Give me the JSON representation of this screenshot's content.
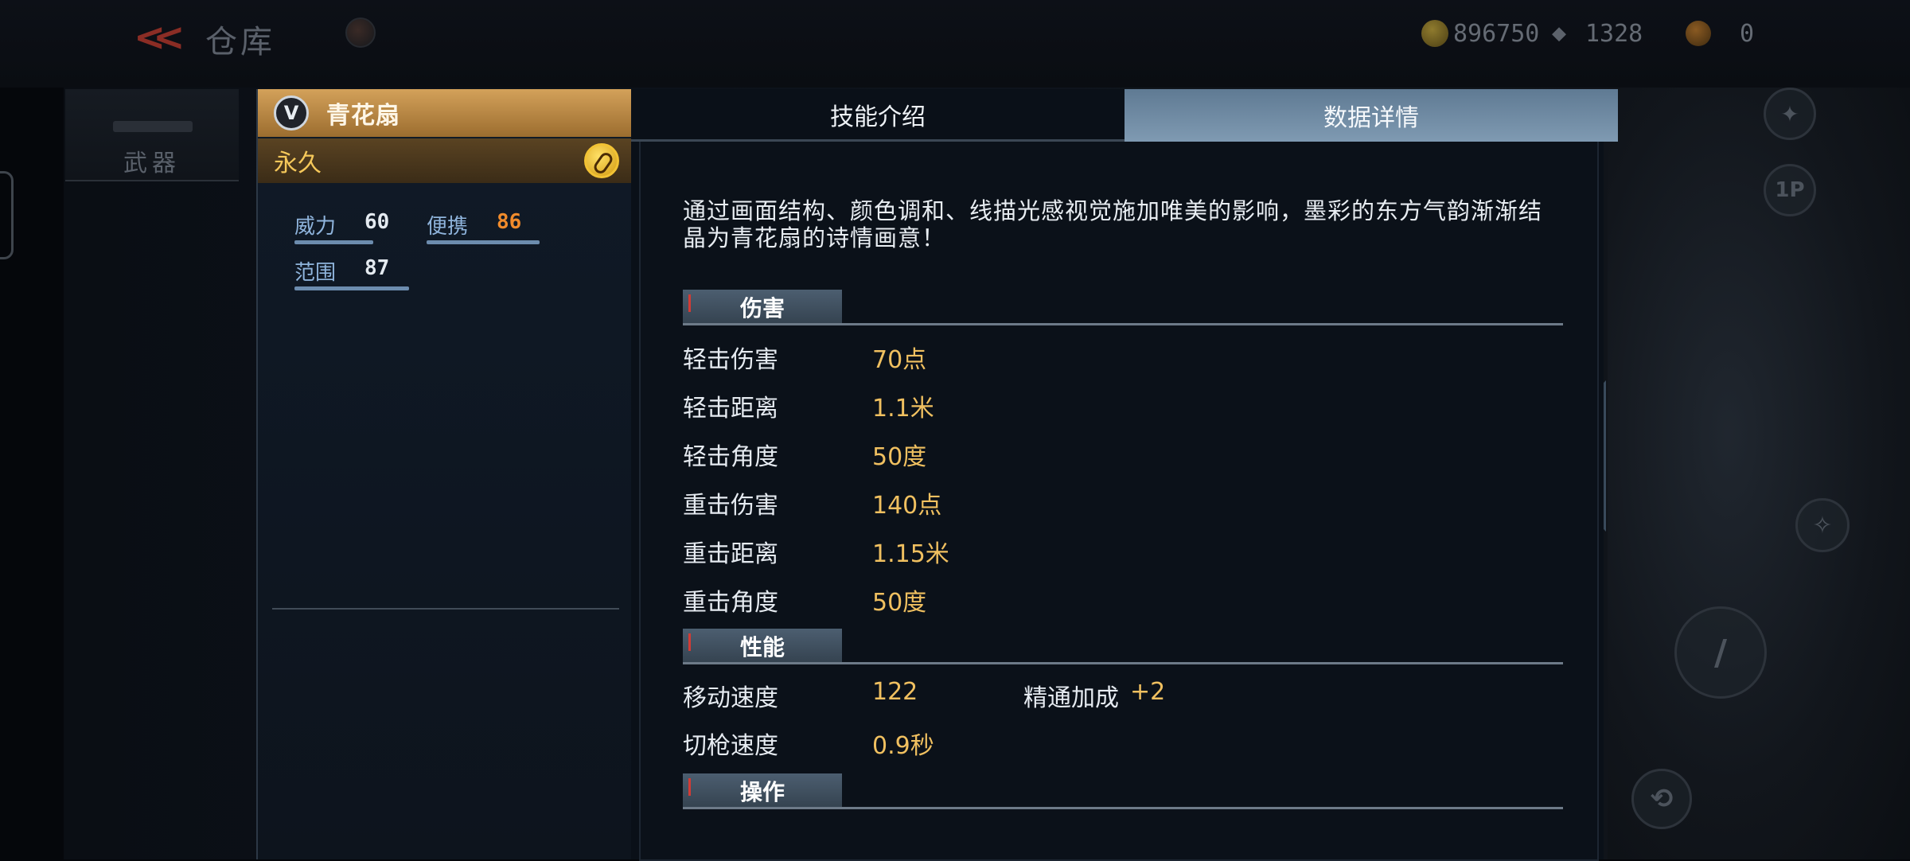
{
  "topbar": {
    "title": "仓库",
    "gold": "896750",
    "diamonds": "1328",
    "tokens": "0"
  },
  "sidebar": {
    "weapon_tab": "武器"
  },
  "right_controls": {
    "mode_label": "1P"
  },
  "item": {
    "badge": "V",
    "name": "青花扇",
    "duration": "永久",
    "stats": [
      {
        "label": "威力",
        "value": "60",
        "fraction": 0.6
      },
      {
        "label": "便携",
        "value": "86",
        "fraction": 0.86
      },
      {
        "label": "范围",
        "value": "87",
        "fraction": 0.87
      }
    ]
  },
  "tabs": [
    {
      "label": "技能介绍",
      "active": false
    },
    {
      "label": "数据详情",
      "active": true
    }
  ],
  "description": "通过画面结构、颜色调和、线描光感视觉施加唯美的影响，墨彩的东方气韵渐渐结晶为青花扇的诗情画意！",
  "sections": [
    {
      "title": "伤害",
      "rows": [
        {
          "label": "轻击伤害",
          "value": "70点"
        },
        {
          "label": "轻击距离",
          "value": "1.1米"
        },
        {
          "label": "轻击角度",
          "value": "50度"
        },
        {
          "label": "重击伤害",
          "value": "140点"
        },
        {
          "label": "重击距离",
          "value": "1.15米"
        },
        {
          "label": "重击角度",
          "value": "50度"
        }
      ]
    },
    {
      "title": "性能",
      "rows": [
        {
          "label": "移动速度",
          "value": "122",
          "extra_label": "精通加成",
          "extra_value": "+2"
        },
        {
          "label": "切枪速度",
          "value": "0.9秒"
        }
      ]
    },
    {
      "title": "操作",
      "rows": []
    }
  ],
  "colors": {
    "header_gold": "#d3a15a",
    "value_gold": "#f0c060",
    "portability_orange": "#f08b2c",
    "active_tab": "#7f9ab2"
  }
}
